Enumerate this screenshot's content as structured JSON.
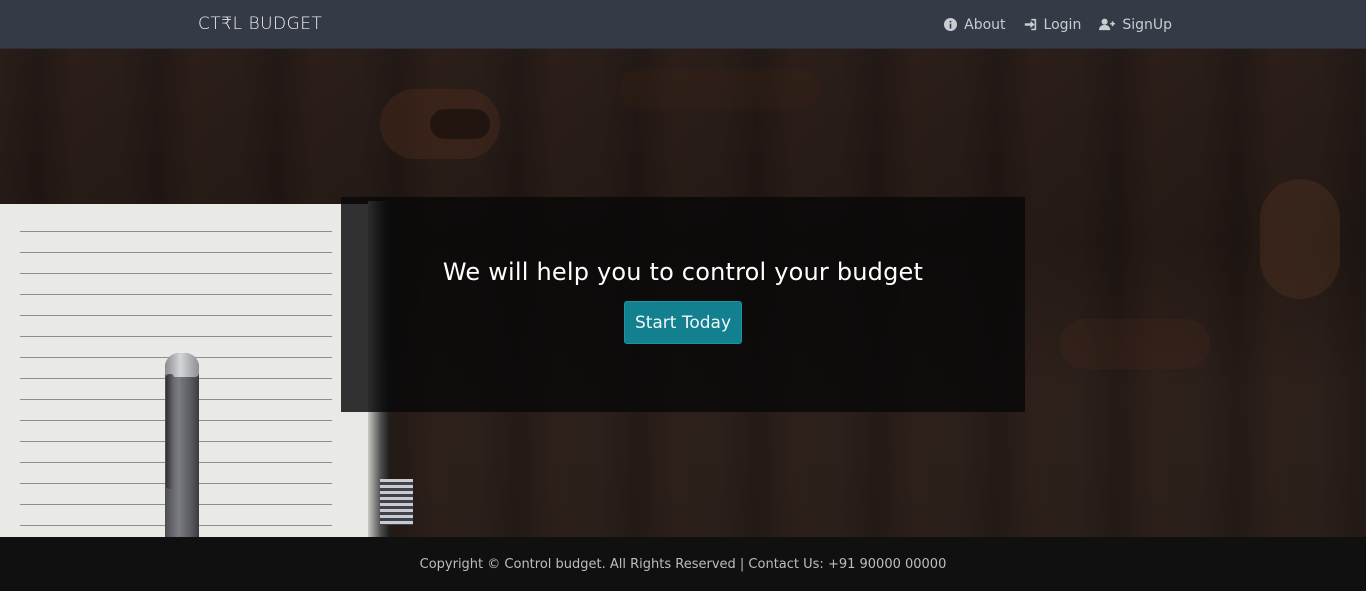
{
  "navbar": {
    "brand": "CT₹L BUDGET",
    "links": [
      {
        "label": "About",
        "icon": "info-circle-icon"
      },
      {
        "label": "Login",
        "icon": "sign-in-icon"
      },
      {
        "label": "SignUp",
        "icon": "user-plus-icon"
      }
    ]
  },
  "hero": {
    "title": "We will help you to control your budget",
    "cta_label": "Start Today"
  },
  "footer": {
    "text": "Copyright © Control budget. All Rights Reserved | Contact Us: +91 90000 00000"
  },
  "colors": {
    "navbar_bg": "#343a46",
    "cta_bg": "#12808f",
    "footer_bg": "#101010"
  }
}
